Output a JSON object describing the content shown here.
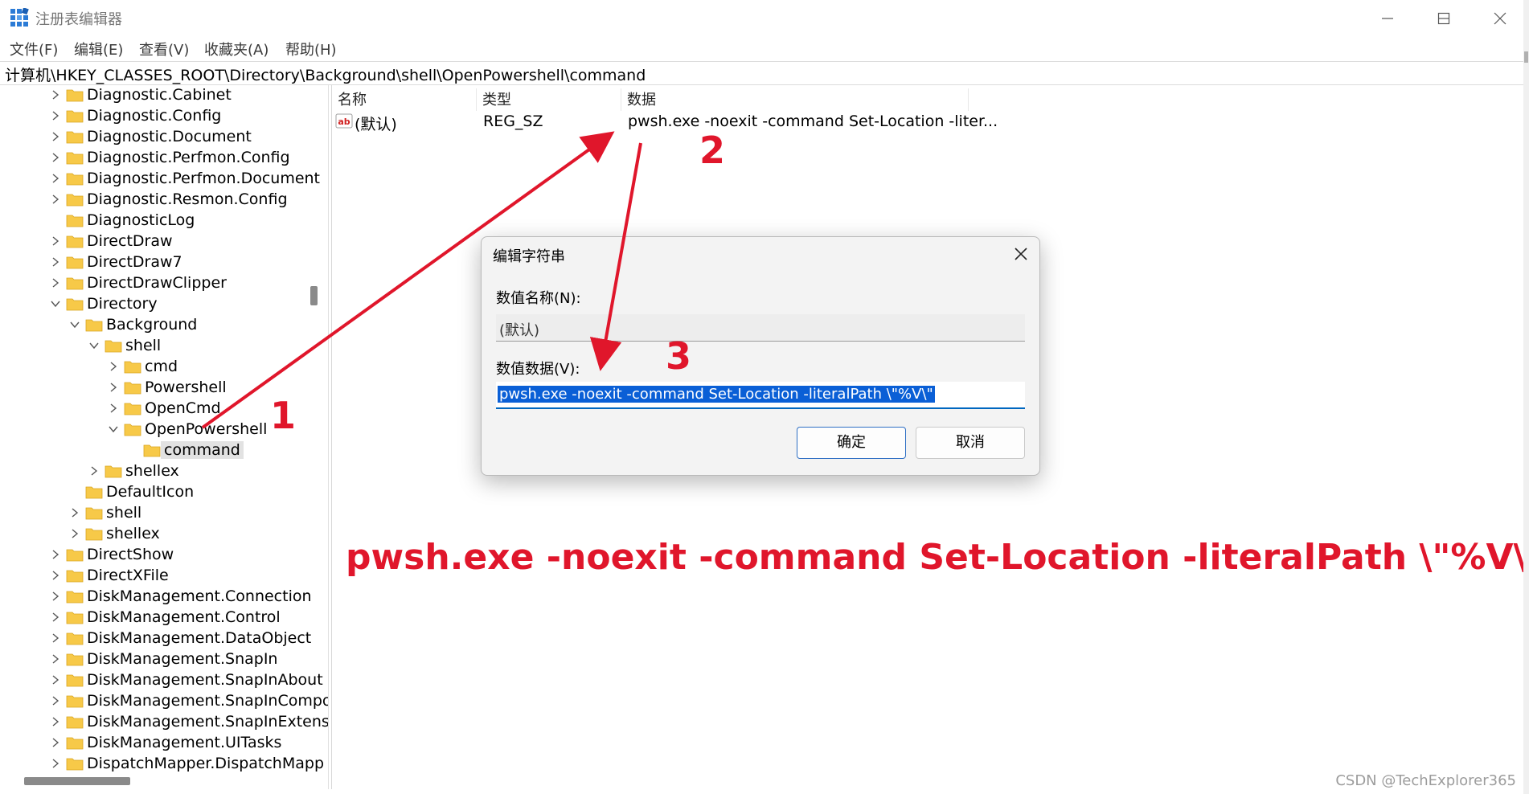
{
  "window": {
    "title": "注册表编辑器"
  },
  "menu": [
    "文件(F)",
    "编辑(E)",
    "查看(V)",
    "收藏夹(A)",
    "帮助(H)"
  ],
  "address": "计算机\\HKEY_CLASSES_ROOT\\Directory\\Background\\shell\\OpenPowershell\\command",
  "tree": [
    {
      "label": "Diagnostic.Cabinet",
      "level": 0,
      "state": "collapsed"
    },
    {
      "label": "Diagnostic.Config",
      "level": 0,
      "state": "collapsed"
    },
    {
      "label": "Diagnostic.Document",
      "level": 0,
      "state": "collapsed"
    },
    {
      "label": "Diagnostic.Perfmon.Config",
      "level": 0,
      "state": "collapsed"
    },
    {
      "label": "Diagnostic.Perfmon.Document",
      "level": 0,
      "state": "collapsed"
    },
    {
      "label": "Diagnostic.Resmon.Config",
      "level": 0,
      "state": "collapsed"
    },
    {
      "label": "DiagnosticLog",
      "level": 0,
      "state": "leaf"
    },
    {
      "label": "DirectDraw",
      "level": 0,
      "state": "collapsed"
    },
    {
      "label": "DirectDraw7",
      "level": 0,
      "state": "collapsed"
    },
    {
      "label": "DirectDrawClipper",
      "level": 0,
      "state": "collapsed"
    },
    {
      "label": "Directory",
      "level": 0,
      "state": "expanded"
    },
    {
      "label": "Background",
      "level": 1,
      "state": "expanded"
    },
    {
      "label": "shell",
      "level": 2,
      "state": "expanded"
    },
    {
      "label": "cmd",
      "level": 3,
      "state": "collapsed"
    },
    {
      "label": "Powershell",
      "level": 3,
      "state": "collapsed"
    },
    {
      "label": "OpenCmd",
      "level": 3,
      "state": "collapsed"
    },
    {
      "label": "OpenPowershell",
      "level": 3,
      "state": "expanded"
    },
    {
      "label": "command",
      "level": 4,
      "state": "leaf",
      "selected": true
    },
    {
      "label": "shellex",
      "level": 2,
      "state": "collapsed"
    },
    {
      "label": "DefaultIcon",
      "level": 1,
      "state": "leaf"
    },
    {
      "label": "shell",
      "level": 1,
      "state": "collapsed"
    },
    {
      "label": "shellex",
      "level": 1,
      "state": "collapsed"
    },
    {
      "label": "DirectShow",
      "level": 0,
      "state": "collapsed"
    },
    {
      "label": "DirectXFile",
      "level": 0,
      "state": "collapsed"
    },
    {
      "label": "DiskManagement.Connection",
      "level": 0,
      "state": "collapsed"
    },
    {
      "label": "DiskManagement.Control",
      "level": 0,
      "state": "collapsed"
    },
    {
      "label": "DiskManagement.DataObject",
      "level": 0,
      "state": "collapsed"
    },
    {
      "label": "DiskManagement.SnapIn",
      "level": 0,
      "state": "collapsed"
    },
    {
      "label": "DiskManagement.SnapInAbout",
      "level": 0,
      "state": "collapsed"
    },
    {
      "label": "DiskManagement.SnapInCompo",
      "level": 0,
      "state": "collapsed"
    },
    {
      "label": "DiskManagement.SnapInExtens",
      "level": 0,
      "state": "collapsed"
    },
    {
      "label": "DiskManagement.UITasks",
      "level": 0,
      "state": "collapsed"
    },
    {
      "label": "DispatchMapper.DispatchMapp",
      "level": 0,
      "state": "collapsed"
    }
  ],
  "list": {
    "headers": {
      "name": "名称",
      "type": "类型",
      "data": "数据"
    },
    "row": {
      "name": "(默认)",
      "type": "REG_SZ",
      "data": "pwsh.exe -noexit -command Set-Location -liter..."
    }
  },
  "dialog": {
    "title": "编辑字符串",
    "name_label": "数值名称(N):",
    "name_value": "(默认)",
    "data_label": "数值数据(V):",
    "data_value": "pwsh.exe -noexit -command Set-Location -literalPath \\\"%V\\\"",
    "ok": "确定",
    "cancel": "取消"
  },
  "annotations": {
    "n1": "1",
    "n2": "2",
    "n3": "3",
    "command": "pwsh.exe -noexit -command Set-Location -literalPath \\\"%V\\\"",
    "color": "#e0162b"
  },
  "watermark": "CSDN @TechExplorer365",
  "colors": {
    "folder": "#f7c948",
    "selection": "#0a5fd6",
    "accent": "#2f6fc4"
  }
}
